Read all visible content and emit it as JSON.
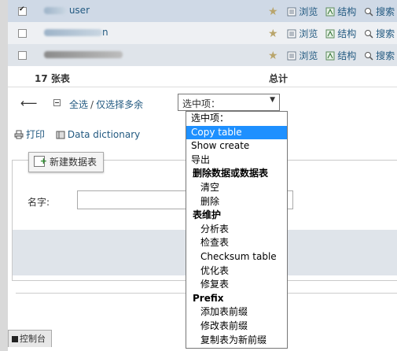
{
  "table_rows": [
    {
      "name": "user",
      "checked": true
    },
    {
      "name": "n",
      "checked": false
    },
    {
      "name": "",
      "checked": false
    }
  ],
  "row_actions": {
    "favorite": "star-icon",
    "browse": "浏览",
    "structure": "结构",
    "search": "搜索"
  },
  "summary": {
    "count": "17 张表",
    "total": "总计"
  },
  "bulk": {
    "check_all": "全选",
    "separator": "/",
    "check_overhead": "仅选择多余"
  },
  "with_selected": {
    "selected_value": "选中项：",
    "options": [
      {
        "label": "选中项：",
        "type": "option"
      },
      {
        "label": "Copy table",
        "type": "option",
        "highlighted": true
      },
      {
        "label": "Show create",
        "type": "option"
      },
      {
        "label": "导出",
        "type": "option"
      },
      {
        "label": "删除数据或数据表",
        "type": "group"
      },
      {
        "label": "清空",
        "type": "child"
      },
      {
        "label": "删除",
        "type": "child"
      },
      {
        "label": "表维护",
        "type": "group"
      },
      {
        "label": "分析表",
        "type": "child"
      },
      {
        "label": "检查表",
        "type": "child"
      },
      {
        "label": "Checksum table",
        "type": "child"
      },
      {
        "label": "优化表",
        "type": "child"
      },
      {
        "label": "修复表",
        "type": "child"
      },
      {
        "label": "Prefix",
        "type": "group"
      },
      {
        "label": "添加表前缀",
        "type": "child"
      },
      {
        "label": "修改表前缀",
        "type": "child"
      },
      {
        "label": "复制表为新前缀",
        "type": "child"
      }
    ]
  },
  "print_bar": {
    "print": "打印",
    "data_dictionary": "Data dictionary"
  },
  "new_table": {
    "button": "新建数据表",
    "name_label": "名字:",
    "name_value": ""
  },
  "console": {
    "label": "控制台"
  },
  "colors": {
    "link": "#235a81",
    "highlight": "#1e90ff",
    "row_band": "#dfe4ea"
  }
}
